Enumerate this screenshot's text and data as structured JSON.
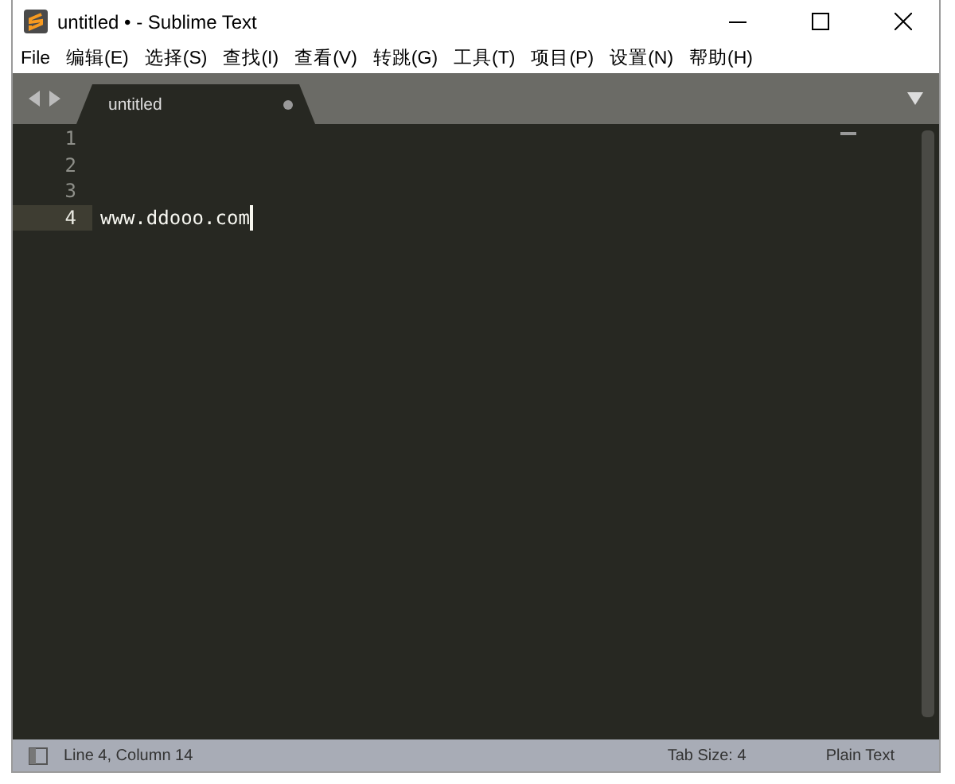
{
  "window": {
    "title": "untitled • - Sublime Text"
  },
  "menu": [
    "File",
    "编辑(E)",
    "选择(S)",
    "查找(I)",
    "查看(V)",
    "转跳(G)",
    "工具(T)",
    "项目(P)",
    "设置(N)",
    "帮助(H)"
  ],
  "tabs": [
    {
      "label": "untitled",
      "selected": true,
      "modified": true
    }
  ],
  "lines": [
    {
      "number": "1",
      "selected": false
    },
    {
      "number": "2",
      "selected": false
    },
    {
      "number": "3",
      "selected": false
    },
    {
      "number": "4",
      "text": "www.ddooo.com",
      "selected": true
    }
  ],
  "status_bar": {
    "position": "Line 4, Column 14",
    "tab_size": "Tab Size: 4",
    "syntax": "Plain Text"
  }
}
